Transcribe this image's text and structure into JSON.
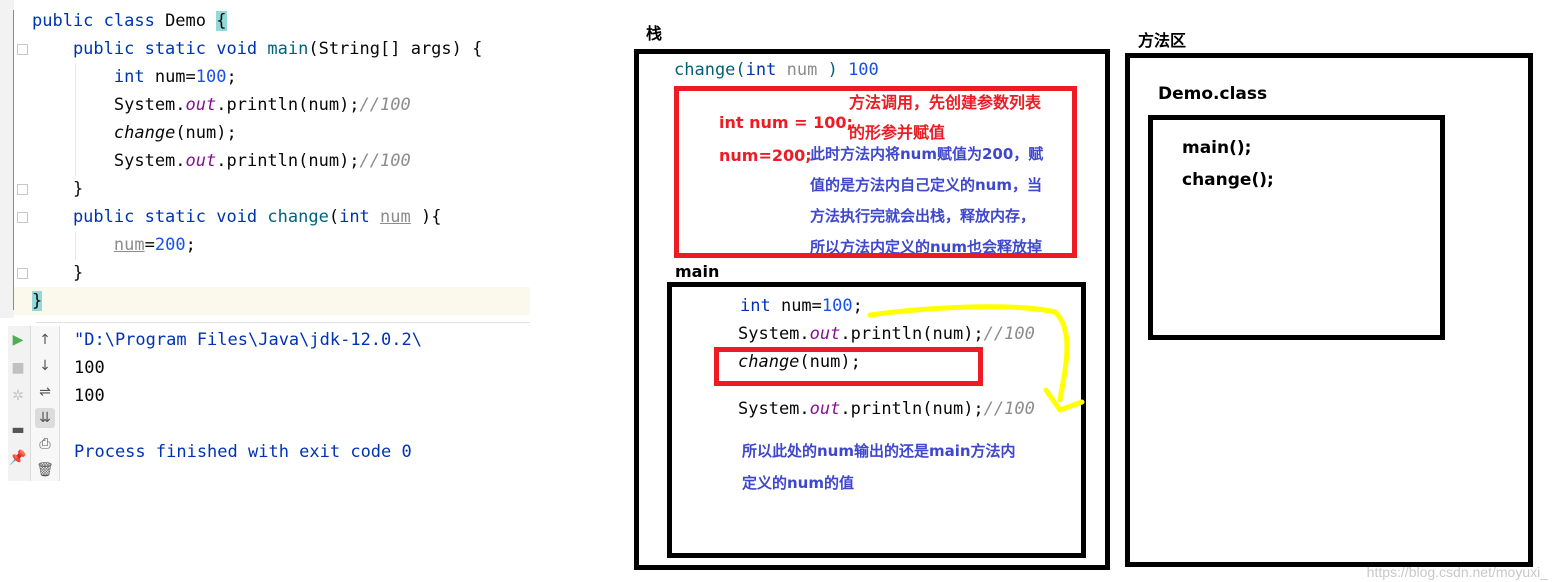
{
  "editor": {
    "lines": [
      {
        "parts": [
          {
            "t": "public class ",
            "c": "kw"
          },
          {
            "t": "Demo ",
            "c": ""
          },
          {
            "t": "{",
            "c": "brace-hl"
          }
        ]
      },
      {
        "parts": [
          {
            "t": "    public static void ",
            "c": "kw"
          },
          {
            "t": "main",
            "c": "mth"
          },
          {
            "t": "(String[] args) {",
            "c": ""
          }
        ]
      },
      {
        "parts": [
          {
            "t": "        int ",
            "c": "kw"
          },
          {
            "t": "num=",
            "c": ""
          },
          {
            "t": "100",
            "c": "num"
          },
          {
            "t": ";",
            "c": ""
          }
        ]
      },
      {
        "parts": [
          {
            "t": "        System.",
            "c": ""
          },
          {
            "t": "out",
            "c": "fld"
          },
          {
            "t": ".println(num);",
            "c": ""
          },
          {
            "t": "//100",
            "c": "cmt"
          }
        ]
      },
      {
        "parts": [
          {
            "t": "        ",
            "c": ""
          },
          {
            "t": "change",
            "c": "ital"
          },
          {
            "t": "(num);",
            "c": ""
          }
        ]
      },
      {
        "parts": [
          {
            "t": "        System.",
            "c": ""
          },
          {
            "t": "out",
            "c": "fld"
          },
          {
            "t": ".println(num);",
            "c": ""
          },
          {
            "t": "//100",
            "c": "cmt"
          }
        ]
      },
      {
        "parts": [
          {
            "t": "    }",
            "c": ""
          }
        ]
      },
      {
        "parts": [
          {
            "t": "    public static void ",
            "c": "kw"
          },
          {
            "t": "change",
            "c": "mth"
          },
          {
            "t": "(",
            "c": ""
          },
          {
            "t": "int ",
            "c": "kw"
          },
          {
            "t": "num",
            "c": "param"
          },
          {
            "t": " ){",
            "c": ""
          }
        ]
      },
      {
        "parts": [
          {
            "t": "        ",
            "c": ""
          },
          {
            "t": "num",
            "c": "param"
          },
          {
            "t": "=",
            "c": ""
          },
          {
            "t": "200",
            "c": "num"
          },
          {
            "t": ";",
            "c": ""
          }
        ]
      },
      {
        "parts": [
          {
            "t": "    }",
            "c": ""
          }
        ]
      },
      {
        "parts": [
          {
            "t": "}",
            "c": "brace-hl"
          }
        ]
      }
    ]
  },
  "console": {
    "lines": [
      {
        "text": "\"D:\\Program Files\\Java\\jdk-12.0.2\\",
        "color": "#0033b3"
      },
      {
        "text": "100",
        "color": "#080808"
      },
      {
        "text": "100",
        "color": "#080808"
      },
      {
        "text": "",
        "color": "#080808"
      },
      {
        "text": "Process finished with exit code 0",
        "color": "#0033b3"
      }
    ],
    "toolbar_left": [
      {
        "icon": "run-icon",
        "glyph": "▶",
        "color": "#4caf50"
      },
      {
        "icon": "stop-icon",
        "glyph": "■",
        "color": "#c0c0c0"
      },
      {
        "icon": "debug-icon",
        "glyph": "✲",
        "color": "#c8c8c8"
      },
      {
        "icon": "layout-icon",
        "glyph": "▬",
        "color": "#555555"
      },
      {
        "icon": "pin-icon",
        "glyph": "📌",
        "color": "#555555"
      }
    ],
    "toolbar_right": [
      {
        "icon": "scroll-up-icon",
        "glyph": "↑"
      },
      {
        "icon": "scroll-down-icon",
        "glyph": "↓"
      },
      {
        "icon": "soft-wrap-icon",
        "glyph": "⇌"
      },
      {
        "icon": "scroll-to-end-icon",
        "glyph": "⇊"
      },
      {
        "icon": "print-icon",
        "glyph": "⎙"
      },
      {
        "icon": "clear-icon",
        "glyph": "🗑"
      }
    ]
  },
  "diagram": {
    "stack_label": "栈",
    "method_area_label": "方法区",
    "change_frame": {
      "header_parts": [
        {
          "t": "change",
          "c": "mth"
        },
        {
          "t": "(",
          "c": "mth"
        },
        {
          "t": "int ",
          "c": "kw"
        },
        {
          "t": "num ",
          "c": "param-plain"
        },
        {
          "t": ")",
          "c": "mth"
        },
        {
          "t": " 100",
          "c": "num"
        }
      ],
      "param_decl": "int num = 100;",
      "assign": "num=200;",
      "note_red": [
        "方法调用，先创建参数列表",
        "的形参并赋值"
      ],
      "note_blue": [
        "此时方法内将num赋值为200，赋",
        "值的是方法内自己定义的num，当",
        "方法执行完就会出栈，释放内存，",
        "所以方法内定义的num也会释放掉"
      ]
    },
    "main_frame": {
      "label": "main",
      "lines": [
        [
          {
            "t": "int ",
            "c": "kw"
          },
          {
            "t": "num=",
            "c": ""
          },
          {
            "t": "100",
            "c": "num"
          },
          {
            "t": ";",
            "c": ""
          }
        ],
        [
          {
            "t": "System.",
            "c": ""
          },
          {
            "t": "out",
            "c": "fld"
          },
          {
            "t": ".println(num);",
            "c": ""
          },
          {
            "t": "//100",
            "c": "cmt"
          }
        ],
        [
          {
            "t": "change",
            "c": "ital"
          },
          {
            "t": "(num);",
            "c": ""
          }
        ],
        [
          {
            "t": "System.",
            "c": ""
          },
          {
            "t": "out",
            "c": "fld"
          },
          {
            "t": ".println(num);",
            "c": ""
          },
          {
            "t": "//100",
            "c": "cmt"
          }
        ]
      ],
      "note_blue": [
        "所以此处的num输出的还是main方法内",
        "定义的num的值"
      ]
    },
    "class_box": {
      "label": "Demo.class",
      "methods": [
        "main();",
        "change();"
      ]
    },
    "colors": {
      "red": "#ed1c24",
      "blue": "#3f48cc",
      "yellow": "#ffff00",
      "black": "#000000"
    },
    "watermark": "https://blog.csdn.net/moyuxi_"
  }
}
